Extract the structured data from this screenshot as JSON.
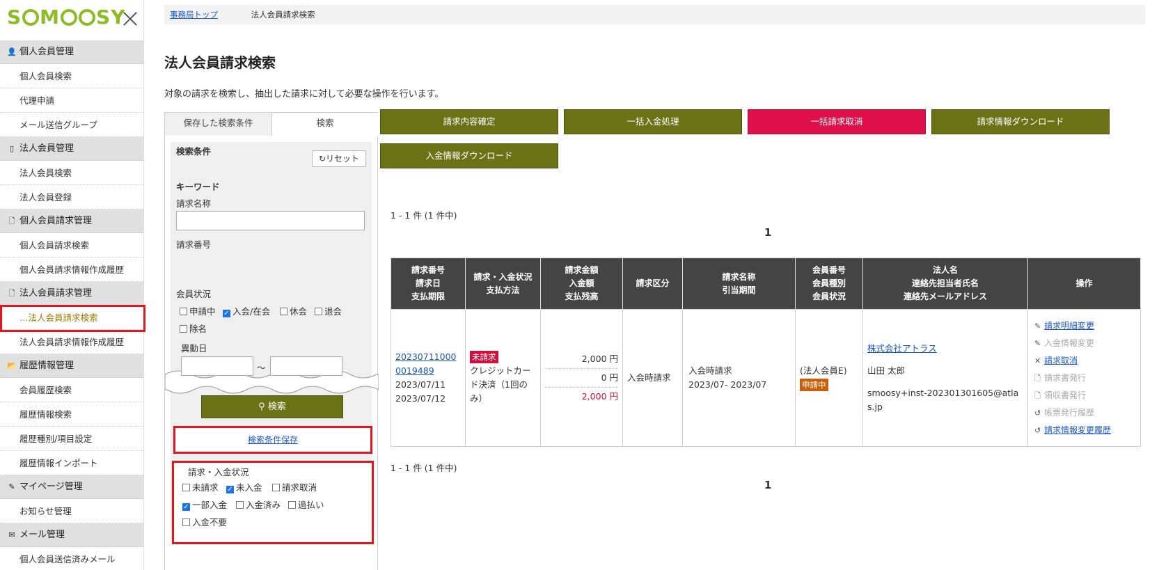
{
  "logo": "SMOOSY",
  "sidebar": [
    {
      "section": "個人会員管理",
      "icon": "person-icon",
      "items": [
        "個人会員検索",
        "代理申請",
        "メール送信グループ"
      ]
    },
    {
      "section": "法人会員管理",
      "icon": "building-icon",
      "items": [
        "法人会員検索",
        "法人会員登録"
      ]
    },
    {
      "section": "個人会員請求管理",
      "icon": "document-icon",
      "items": [
        "個人会員請求検索",
        "個人会員請求情報作成履歴"
      ]
    },
    {
      "section": "法人会員請求管理",
      "icon": "document-icon",
      "items": [
        "…法人会員請求検索",
        "法人会員請求情報作成履歴"
      ]
    },
    {
      "section": "履歴情報管理",
      "icon": "folder-icon",
      "items": [
        "会員履歴検索",
        "履歴情報検索",
        "履歴種別/項目設定",
        "履歴情報インポート"
      ]
    },
    {
      "section": "マイページ管理",
      "icon": "pencil-icon",
      "items": [
        "お知らせ管理"
      ]
    },
    {
      "section": "メール管理",
      "icon": "mail-icon",
      "items": [
        "個人会員送信済みメール"
      ]
    }
  ],
  "breadcrumb": {
    "home": "事務局トップ",
    "current": "法人会員請求検索"
  },
  "page": {
    "title": "法人会員請求検索",
    "description": "対象の請求を検索し、抽出した請求に対して必要な操作を行います。"
  },
  "search": {
    "tab_saved": "保存した検索条件",
    "tab_search": "検索",
    "conditions_label": "検索条件",
    "reset_label": "リセット",
    "keyword_label": "キーワード",
    "billing_name_label": "請求名称",
    "billing_number_label": "請求番号",
    "member_status_label": "会員状況",
    "member_status": [
      {
        "label": "申請中",
        "checked": false
      },
      {
        "label": "入会/在会",
        "checked": true
      },
      {
        "label": "休会",
        "checked": false
      },
      {
        "label": "退会",
        "checked": false
      },
      {
        "label": "除名",
        "checked": false
      }
    ],
    "change_date_label": "異動日",
    "range_sep": "～",
    "search_button": "検索",
    "save_conditions": "検索条件保存",
    "billing_status_label": "請求・入金状況",
    "billing_status": [
      {
        "label": "未請求",
        "checked": false
      },
      {
        "label": "未入金",
        "checked": true
      },
      {
        "label": "請求取消",
        "checked": false
      },
      {
        "label": "一部入金",
        "checked": true
      },
      {
        "label": "入金済み",
        "checked": false
      },
      {
        "label": "過払い",
        "checked": false
      },
      {
        "label": "入金不要",
        "checked": false
      }
    ]
  },
  "actions": [
    "請求内容確定",
    "一括入金処理",
    "一括請求取消",
    "請求情報ダウンロード",
    "入金情報ダウンロード"
  ],
  "results": {
    "count_text": "1 - 1 件 (1 件中)",
    "page": "1"
  },
  "table": {
    "headers": [
      [
        "請求番号",
        "請求日",
        "支払期限"
      ],
      [
        "請求・入金状況",
        "支払方法"
      ],
      [
        "請求金額",
        "入金額",
        "支払残高"
      ],
      [
        "請求区分"
      ],
      [
        "請求名称",
        "引当期間"
      ],
      [
        "会員番号",
        "会員種別",
        "会員状況"
      ],
      [
        "法人名",
        "連絡先担当者氏名",
        "連絡先メールアドレス"
      ],
      [
        "操作"
      ]
    ],
    "row": {
      "billing_no_1": "20230711000",
      "billing_no_2": "0019489",
      "billing_date": "2023/07/11",
      "due_date": "2023/07/12",
      "status_badge": "未請求",
      "payment_method": "クレジットカード決済（1回のみ）",
      "amount_billed": "2,000 円",
      "amount_paid": "0 円",
      "amount_remaining": "2,000 円",
      "billing_category": "入会時請求",
      "billing_name": "入会時請求",
      "period": "2023/07- 2023/07",
      "member_type": "(法人会員E)",
      "member_status_badge": "申請中",
      "company": "株式会社アトラス",
      "contact_name": "山田 太郎",
      "contact_email": "smoosy+inst-202301301605@atlas.jp",
      "operations": [
        {
          "label": "請求明細変更",
          "enabled": true,
          "icon": "pencil-icon"
        },
        {
          "label": "入金情報変更",
          "enabled": false,
          "icon": "pencil-icon"
        },
        {
          "label": "請求取消",
          "enabled": true,
          "icon": "x-icon"
        },
        {
          "label": "請求書発行",
          "enabled": false,
          "icon": "document-icon"
        },
        {
          "label": "領収書発行",
          "enabled": false,
          "icon": "document-icon"
        },
        {
          "label": "帳票発行履歴",
          "enabled": false,
          "icon": "history-icon"
        },
        {
          "label": "請求情報変更履歴",
          "enabled": true,
          "icon": "history-icon"
        }
      ]
    }
  },
  "colors": {
    "olive": "#6b7216",
    "danger": "#e0104a",
    "highlight": "#e3161d",
    "badge_red": "#d0103a",
    "badge_orange": "#c8600a"
  }
}
